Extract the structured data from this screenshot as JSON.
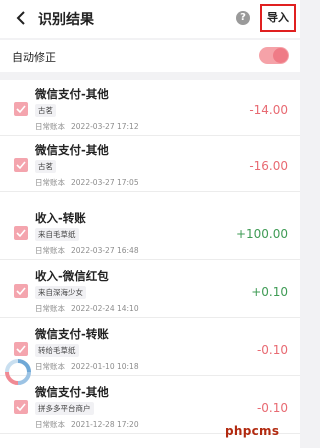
{
  "header": {
    "title": "识别结果",
    "help_symbol": "?",
    "import_label": "导入"
  },
  "auto_fix": {
    "label": "自动修正",
    "enabled": true
  },
  "items": [
    {
      "name": "微信支付-其他",
      "tag": "古茗",
      "book": "日常账本",
      "time": "2022-03-27 17:12",
      "amount": "-14.00",
      "checked": true
    },
    {
      "name": "微信支付-其他",
      "tag": "古茗",
      "book": "日常账本",
      "time": "2022-03-27 17:05",
      "amount": "-16.00",
      "checked": true
    },
    {
      "name": "收入-转账",
      "tag": "来自毛草纸",
      "book": "日常账本",
      "time": "2022-03-27 16:48",
      "amount": "+100.00",
      "checked": true
    },
    {
      "name": "收入-微信红包",
      "tag": "来自深海少女",
      "book": "日常账本",
      "time": "2022-02-24 14:10",
      "amount": "+0.10",
      "checked": true
    },
    {
      "name": "微信支付-转账",
      "tag": "转给毛草纸",
      "book": "日常账本",
      "time": "2022-01-10 10:18",
      "amount": "-0.10",
      "checked": true
    },
    {
      "name": "微信支付-其他",
      "tag": "拼多多平台商户",
      "book": "日常账本",
      "time": "2021-12-28 17:20",
      "amount": "-0.10",
      "checked": true
    }
  ],
  "watermark": "phpcms",
  "colors": {
    "negative": "#e86a72",
    "positive": "#3f9b55",
    "accent": "#f4a5ae",
    "highlight_border": "#e02020"
  }
}
